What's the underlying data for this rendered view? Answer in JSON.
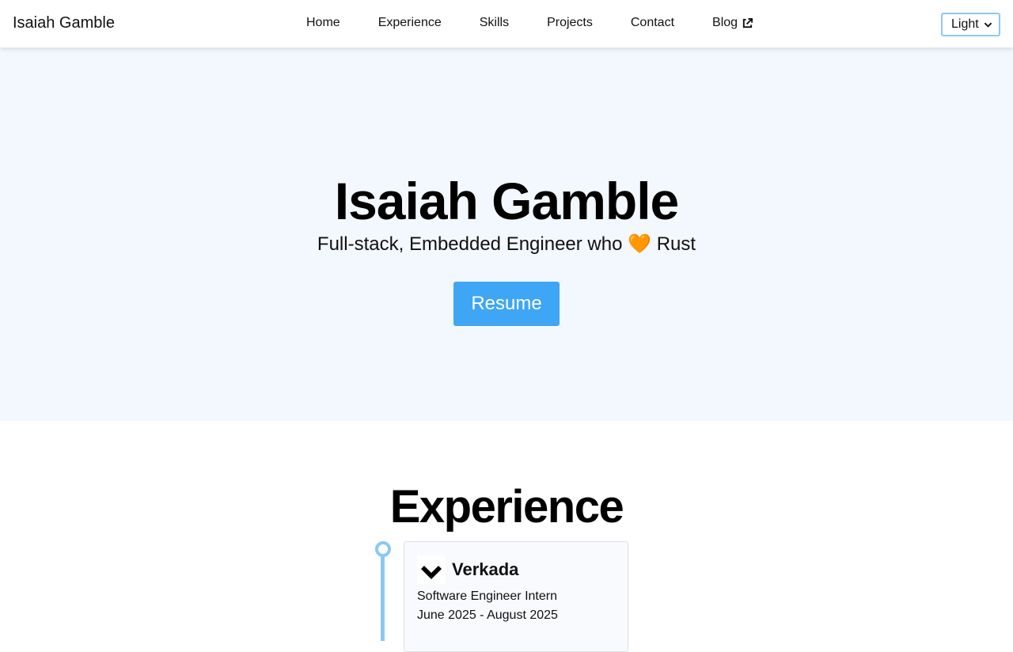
{
  "nav": {
    "brand": "Isaiah Gamble",
    "links": [
      "Home",
      "Experience",
      "Skills",
      "Projects",
      "Contact",
      "Blog"
    ],
    "theme": {
      "selected": "Light"
    }
  },
  "hero": {
    "title": "Isaiah Gamble",
    "subtitle_before": "Full-stack, Embedded Engineer who",
    "subtitle_emoji": "🧡",
    "subtitle_after": "Rust",
    "resume_label": "Resume"
  },
  "experience": {
    "title": "Experience",
    "items": [
      {
        "company": "Verkada",
        "role": "Software Engineer Intern",
        "dates": "June 2025 - August 2025"
      }
    ]
  },
  "colors": {
    "accent": "#3ea6f5",
    "timeline": "#8cc8f5",
    "hero_bg": "#f3f7fe"
  }
}
